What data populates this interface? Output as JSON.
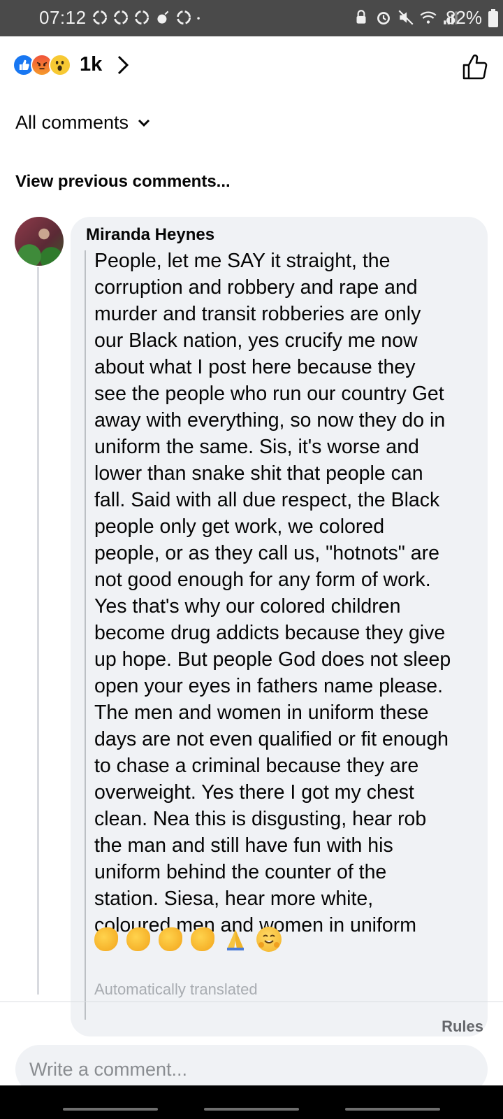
{
  "status_bar": {
    "time": "07:12",
    "battery": "82%",
    "notification_icons": [
      "recycle-icon",
      "recycle-icon",
      "recycle-icon",
      "bomb-icon",
      "recycle-icon",
      "dot-icon"
    ],
    "system_icons": [
      "lock-icon",
      "alarm-icon",
      "mute-icon",
      "wifi-icon",
      "signal-icon",
      "battery-icon"
    ]
  },
  "header": {
    "reactions": [
      "like-icon",
      "angry-icon",
      "wow-icon"
    ],
    "reaction_count": "1k"
  },
  "filter": {
    "label": "All comments"
  },
  "comments_section": {
    "view_previous": "View previous comments..."
  },
  "comment": {
    "author": "Miranda Heynes",
    "text": "People, let me SAY it straight, the\ncorruption and robbery and rape and\nmurder and transit robberies are only\nour Black nation, yes crucify me now\nabout what I post here because they\nsee the people who run our country Get\naway with everything, so now they do in\nuniform the same. Sis, it's worse and\nlower than snake shit that people can\nfall. Said with all due respect, the Black\npeople only get work, we colored\npeople, or as they call us, \"hotnots\" are\nnot good enough for any form of work.\nYes that's why our colored children\nbecome drug addicts because they give\nup hope. But people God does not sleep\nopen your eyes in fathers name please.\nThe men and women in uniform these\ndays are not even qualified or fit enough\nto chase a criminal because they are\noverweight. Yes there I got my chest\nclean. Nea this is disgusting, hear rob\nthe man and still have fun with his\nuniform behind the counter of the\nstation. Siesa, hear more white,\ncoloured men and women in uniform",
    "emojis": [
      "clap-emoji",
      "clap-emoji",
      "clap-emoji",
      "clap-emoji",
      "pray-emoji",
      "hug-emoji"
    ],
    "translation_note": "Automatically translated"
  },
  "footer": {
    "rules": "Rules",
    "input_placeholder": "Write a comment..."
  },
  "colors": {
    "brand_blue": "#1877f2",
    "bubble_bg": "#f0f2f5",
    "muted_text": "#65676b"
  }
}
